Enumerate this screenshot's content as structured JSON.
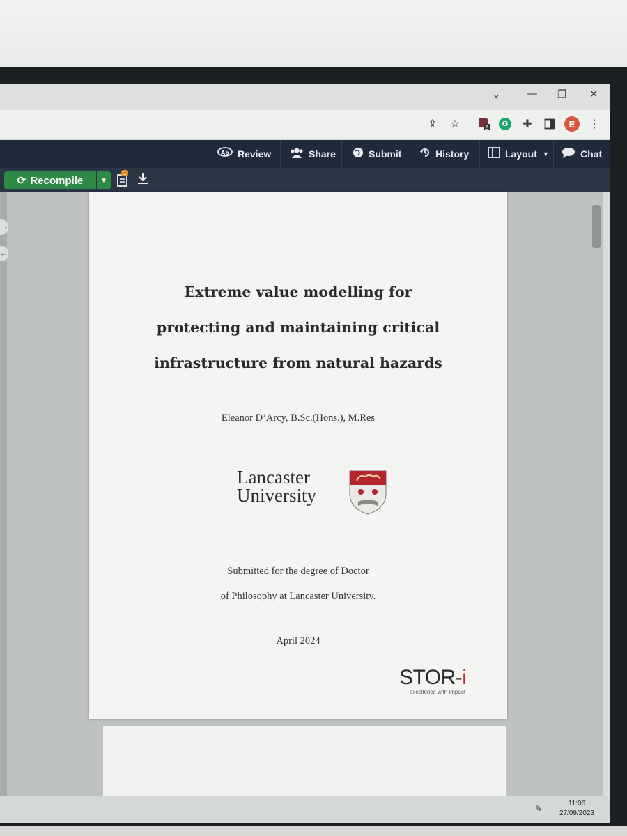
{
  "browser": {
    "toolbar_icons": [
      "share-icon",
      "star-icon",
      "extension-badge-icon",
      "grammarly-icon",
      "puzzle-icon",
      "sidepanel-icon",
      "profile-avatar",
      "menu-icon"
    ],
    "badge_count": "2",
    "avatar_letter": "E",
    "avatar_color": "#d5563a",
    "grammarly_letter": "G",
    "grammarly_color": "#1aa56b"
  },
  "overleaf_nav": {
    "items": [
      {
        "label": "Review",
        "icon": "review-icon"
      },
      {
        "label": "Share",
        "icon": "share-users-icon"
      },
      {
        "label": "Submit",
        "icon": "globe-icon"
      },
      {
        "label": "History",
        "icon": "history-icon"
      },
      {
        "label": "Layout",
        "icon": "layout-icon"
      },
      {
        "label": "Chat",
        "icon": "chat-icon"
      }
    ]
  },
  "pdf_toolbar": {
    "recompile_label": "Recompile",
    "recompile_color": "#2f8a45",
    "logs_badge": "1"
  },
  "document": {
    "title_lines": [
      "Extreme value modelling for",
      "protecting and maintaining critical",
      "infrastructure from natural hazards"
    ],
    "author": "Eleanor D’Arcy, B.Sc.(Hons.), M.Res",
    "logo": {
      "line1": "Lancaster",
      "line2": "University"
    },
    "submitted_lines": [
      "Submitted for the degree of Doctor",
      "of Philosophy at Lancaster University."
    ],
    "date": "April 2024",
    "stor": {
      "name": "STOR-",
      "accent": "i",
      "tagline": "excellence with impact",
      "accent_color": "#c0282a"
    }
  },
  "taskbar": {
    "time": "11:06",
    "date": "27/09/2023"
  }
}
